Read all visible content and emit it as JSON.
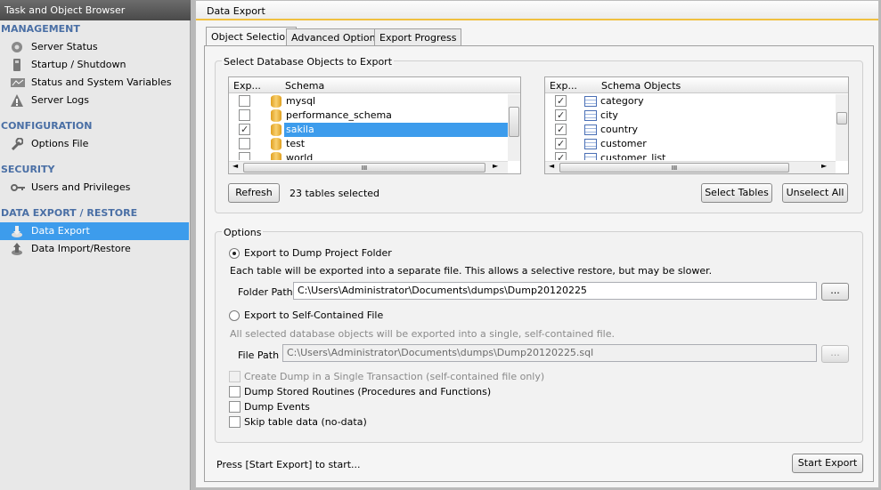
{
  "sidebar": {
    "title": "Task and Object Browser",
    "sections": [
      {
        "heading": "MANAGEMENT",
        "items": [
          {
            "label": "Server Status",
            "icon": "server-status-icon"
          },
          {
            "label": "Startup / Shutdown",
            "icon": "startup-icon"
          },
          {
            "label": "Status and System Variables",
            "icon": "variables-icon"
          },
          {
            "label": "Server Logs",
            "icon": "warning-icon"
          }
        ]
      },
      {
        "heading": "CONFIGURATION",
        "items": [
          {
            "label": "Options File",
            "icon": "wrench-icon"
          }
        ]
      },
      {
        "heading": "SECURITY",
        "items": [
          {
            "label": "Users and Privileges",
            "icon": "key-icon"
          }
        ]
      },
      {
        "heading": "DATA EXPORT / RESTORE",
        "items": [
          {
            "label": "Data Export",
            "icon": "export-icon",
            "selected": true
          },
          {
            "label": "Data Import/Restore",
            "icon": "import-icon"
          }
        ]
      }
    ]
  },
  "main": {
    "title": "Data Export",
    "tabs": [
      "Object Selection",
      "Advanced Options",
      "Export Progress"
    ],
    "active_tab": "Object Selection",
    "select_group": {
      "title": "Select Database Objects to Export",
      "schema_list": {
        "col_export": "Exp...",
        "col_schema": "Schema",
        "rows": [
          {
            "name": "mysql",
            "checked": false
          },
          {
            "name": "performance_schema",
            "checked": false
          },
          {
            "name": "sakila",
            "checked": true,
            "selected": true
          },
          {
            "name": "test",
            "checked": false
          },
          {
            "name": "world",
            "checked": false
          }
        ]
      },
      "objects_list": {
        "col_export": "Exp...",
        "col_objects": "Schema Objects",
        "rows": [
          {
            "name": "category",
            "checked": true
          },
          {
            "name": "city",
            "checked": true
          },
          {
            "name": "country",
            "checked": true
          },
          {
            "name": "customer",
            "checked": true
          },
          {
            "name": "customer_list",
            "checked": true
          }
        ]
      },
      "scroll_grip": "III",
      "refresh_label": "Refresh",
      "tables_selected": "23 tables selected",
      "select_tables_label": "Select Tables",
      "unselect_all_label": "Unselect All"
    },
    "options": {
      "title": "Options",
      "export_folder_label": "Export to Dump Project Folder",
      "export_folder_desc": "Each table will be exported into a separate file. This allows a selective restore, but may be slower.",
      "folder_path_label": "Folder Path",
      "folder_path_value": "C:\\Users\\Administrator\\Documents\\dumps\\Dump20120225",
      "browse_label": "...",
      "export_file_label": "Export to Self-Contained File",
      "export_file_desc": "All selected database objects will be exported into a single, self-contained file.",
      "file_path_label": "File Path",
      "file_path_value": "C:\\Users\\Administrator\\Documents\\dumps\\Dump20120225.sql",
      "single_transaction_label": "Create Dump in a Single Transaction (self-contained file only)",
      "routines_label": "Dump Stored Routines (Procedures and Functions)",
      "events_label": "Dump Events",
      "skip_data_label": "Skip table data (no-data)"
    },
    "status_text": "Press [Start Export] to start...",
    "start_export_label": "Start Export"
  }
}
